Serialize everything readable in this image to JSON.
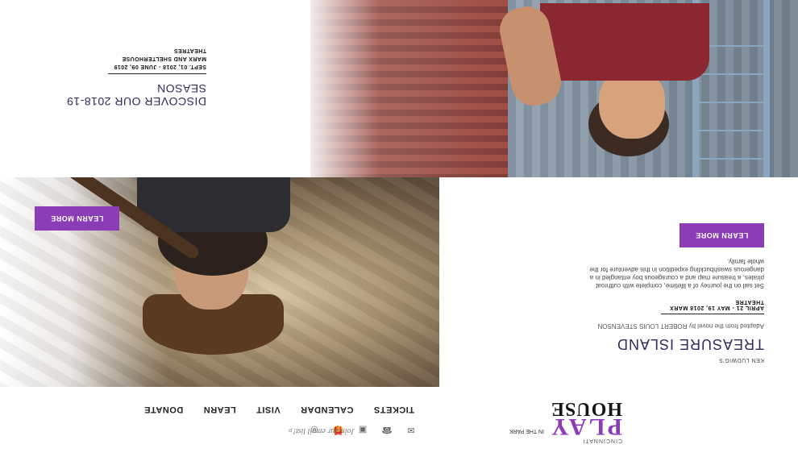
{
  "header": {
    "logo": {
      "cincinnati": "CINCINNATI",
      "play": "PLAY",
      "in_the_park": "IN THE PARK",
      "house": "HOUSE"
    },
    "nav": [
      "TICKETS",
      "CALENDAR",
      "VISIT",
      "LEARN",
      "DONATE"
    ],
    "email_prompt": "Join our email list!",
    "social_icons": [
      "email-icon",
      "phone-icon",
      "ticket-icon",
      "gift-icon",
      "instagram-icon",
      "search-icon"
    ]
  },
  "feature": {
    "author": "KEN LUDWIG'S",
    "title": "TREASURE ISLAND",
    "adapted": "Adapted from the novel by ROBERT LOUIS STEVENSON",
    "dates": "APRIL 21 - MAY 19, 2018",
    "venue": "MARX THEATRE",
    "description": "Set sail on the journey of a lifetime, complete with cutthroat pirates, a treasure map and a courageous boy entangled in a dangerous swashbuckling expedition in this adventure for the whole family.",
    "button": "LEARN MORE"
  },
  "season": {
    "title": "DISCOVER OUR 2018-19 SEASON",
    "dates": "SEPT. 01, 2018 - JUNE 09, 2019",
    "venue": "MARX AND SHELTERHOUSE THEATRES",
    "button": "LEARN MORE"
  },
  "colors": {
    "accent": "#8b3cb7",
    "title": "#2e2a5c"
  }
}
